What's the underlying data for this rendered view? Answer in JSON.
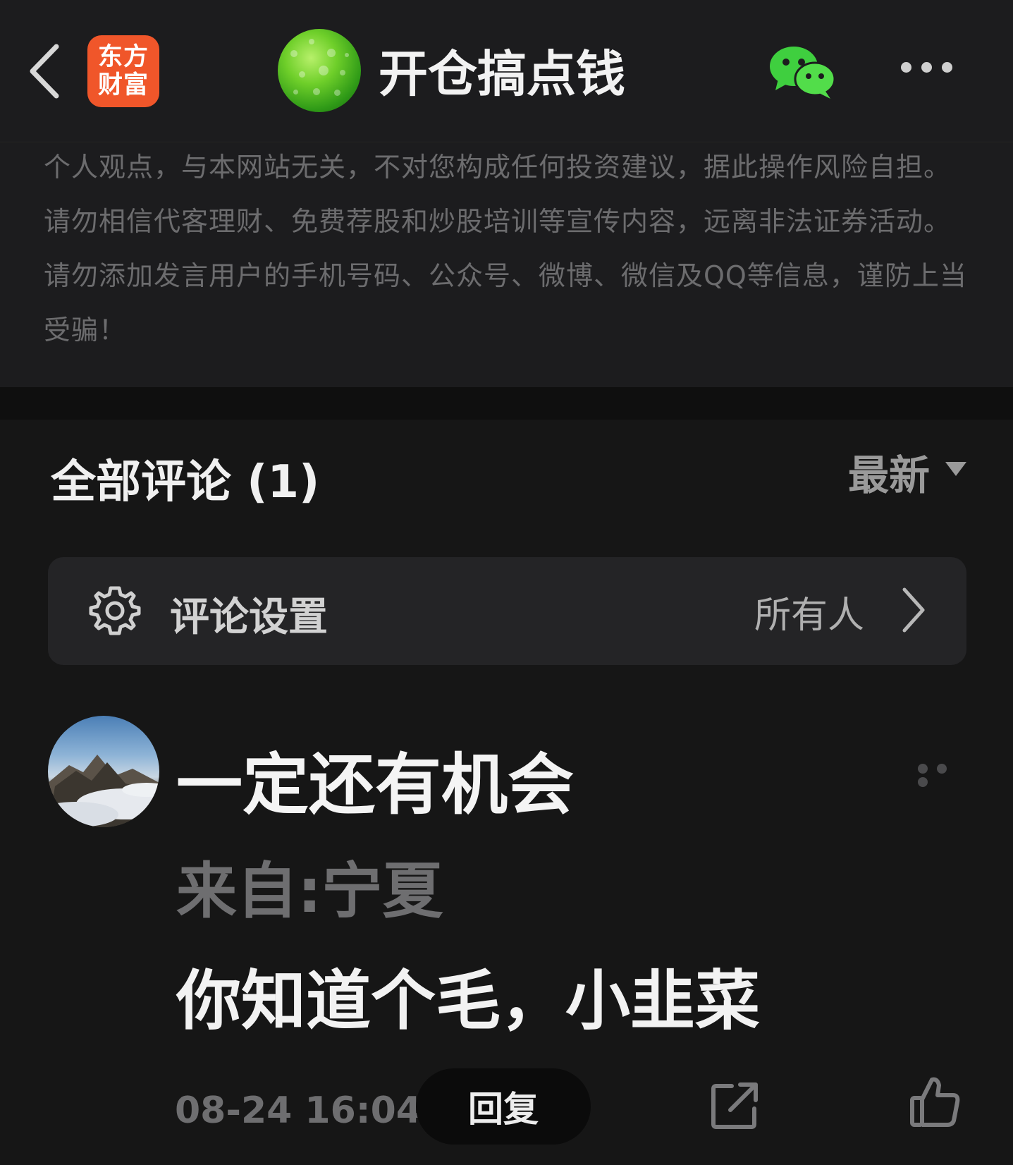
{
  "header": {
    "app_logo_line1": "东方",
    "app_logo_line2": "财富",
    "channel_title": "开仓搞点钱"
  },
  "disclaimer": {
    "text": "个人观点，与本网站无关，不对您构成任何投资建议，据此操作风险自担。请勿相信代客理财、免费荐股和炒股培训等宣传内容，远离非法证券活动。请勿添加发言用户的手机号码、公众号、微博、微信及QQ等信息，谨防上当受骗！"
  },
  "comments_section": {
    "header": "全部评论 (1)",
    "sort_label": "最新",
    "settings": {
      "label": "评论设置",
      "value": "所有人"
    }
  },
  "comment": {
    "username": "一定还有机会",
    "location": "来自:宁夏",
    "body": "你知道个毛，小韭菜",
    "timestamp": "08-24 16:04",
    "reply_label": "回复"
  },
  "icons": {
    "back": "chevron-left-icon",
    "wechat": "wechat-icon",
    "more": "more-horizontal-icon",
    "sort_caret": "caret-down-icon",
    "gear": "gear-icon",
    "chevron": "chevron-right-icon",
    "share": "share-icon",
    "like": "thumbs-up-icon"
  },
  "colors": {
    "brand_orange": "#f0562a",
    "wechat_green": "#3fcf3f",
    "background": "#161616"
  }
}
